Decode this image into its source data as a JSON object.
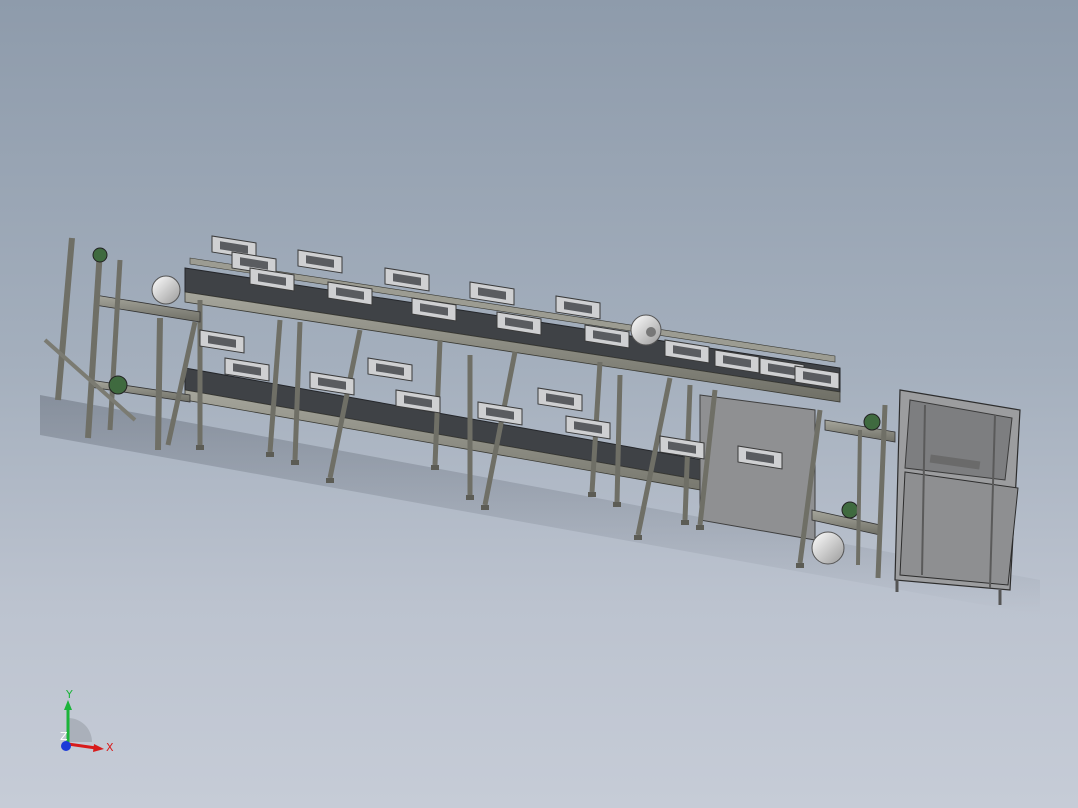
{
  "viewport": {
    "background_top": "#8e9bab",
    "background_bottom": "#c6ccd7"
  },
  "model": {
    "frame_color": "#8a8a80",
    "belt_color": "#3f4246",
    "motor_color": "#e8e8e8",
    "panel_color": "#8f9092",
    "icon": "conveyor-assembly-icon"
  },
  "triad": {
    "x_label": "X",
    "y_label": "Y",
    "z_label": "Z",
    "x_color": "#d81b1b",
    "y_color": "#1bb43a",
    "z_color": "#1b3ad8"
  }
}
